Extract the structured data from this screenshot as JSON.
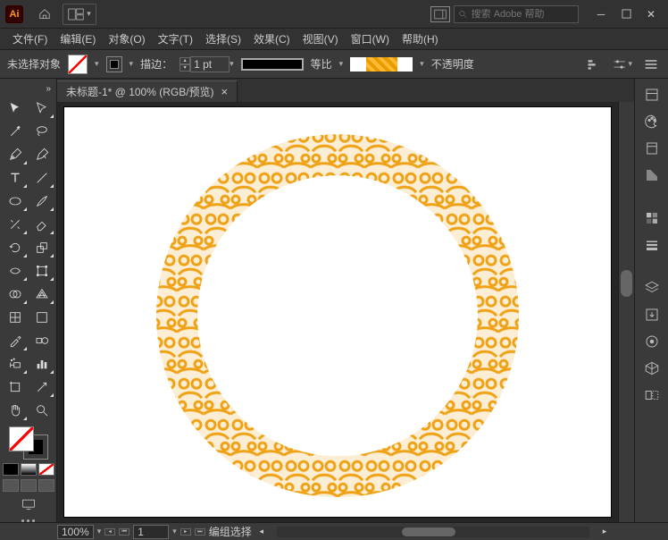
{
  "app": {
    "logo_text": "Ai"
  },
  "search": {
    "placeholder": "搜索 Adobe 帮助"
  },
  "menu": {
    "file": "文件(F)",
    "edit": "编辑(E)",
    "object": "对象(O)",
    "type": "文字(T)",
    "select": "选择(S)",
    "effect": "效果(C)",
    "view": "视图(V)",
    "window": "窗口(W)",
    "help": "帮助(H)"
  },
  "control": {
    "no_selection": "未选择对象",
    "stroke_label": "描边：",
    "stroke_weight": "1 pt",
    "uniform": "等比",
    "opacity_label": "不透明度"
  },
  "tab": {
    "title": "未标题-1* @ 100% (RGB/预览)"
  },
  "status": {
    "zoom": "100%",
    "artboard": "1",
    "tool_hint": "编组选择"
  }
}
